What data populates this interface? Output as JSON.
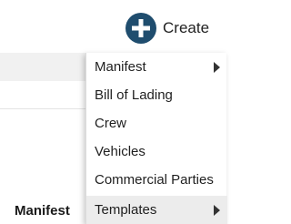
{
  "header": {
    "create_label": "Create"
  },
  "left_panel": {
    "active_tab_label": "Manifest"
  },
  "menu": {
    "items": [
      {
        "label": "Manifest",
        "has_submenu": true
      },
      {
        "label": "Bill of Lading",
        "has_submenu": false
      },
      {
        "label": "Crew",
        "has_submenu": false
      },
      {
        "label": "Vehicles",
        "has_submenu": false
      },
      {
        "label": "Commercial Parties",
        "has_submenu": false
      },
      {
        "label": "Templates",
        "has_submenu": true
      }
    ]
  },
  "icons": {
    "create": "plus-circle-icon",
    "submenu": "chevron-right-icon"
  },
  "colors": {
    "create_icon_bg": "#1f4d6e",
    "create_icon_fg": "#ffffff",
    "frame_border": "#c8ddec",
    "band": "#f1f1f1"
  }
}
